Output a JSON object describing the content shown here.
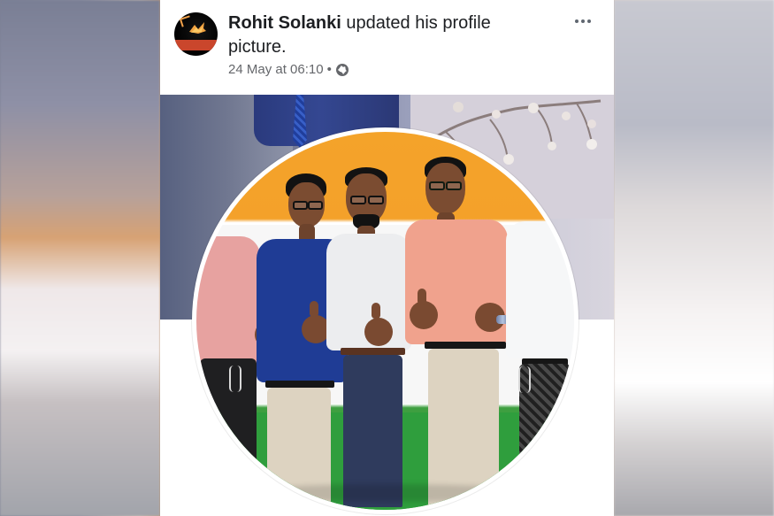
{
  "post": {
    "author": "Rohit Solanki",
    "action": " updated his profile picture.",
    "timestamp": "24 May at 06:10",
    "separator": " • ",
    "visibility_icon": "globe-icon",
    "more_icon": "more-options-icon"
  },
  "colors": {
    "text_primary": "#1c1e21",
    "text_secondary": "#65676b",
    "card_background": "#ffffff",
    "cover_blue": "#6b7294",
    "photo_orange": "#f4a32a",
    "photo_green": "#2f9e3d"
  },
  "people": {
    "count": 5,
    "gesture": "thumbs-up"
  }
}
